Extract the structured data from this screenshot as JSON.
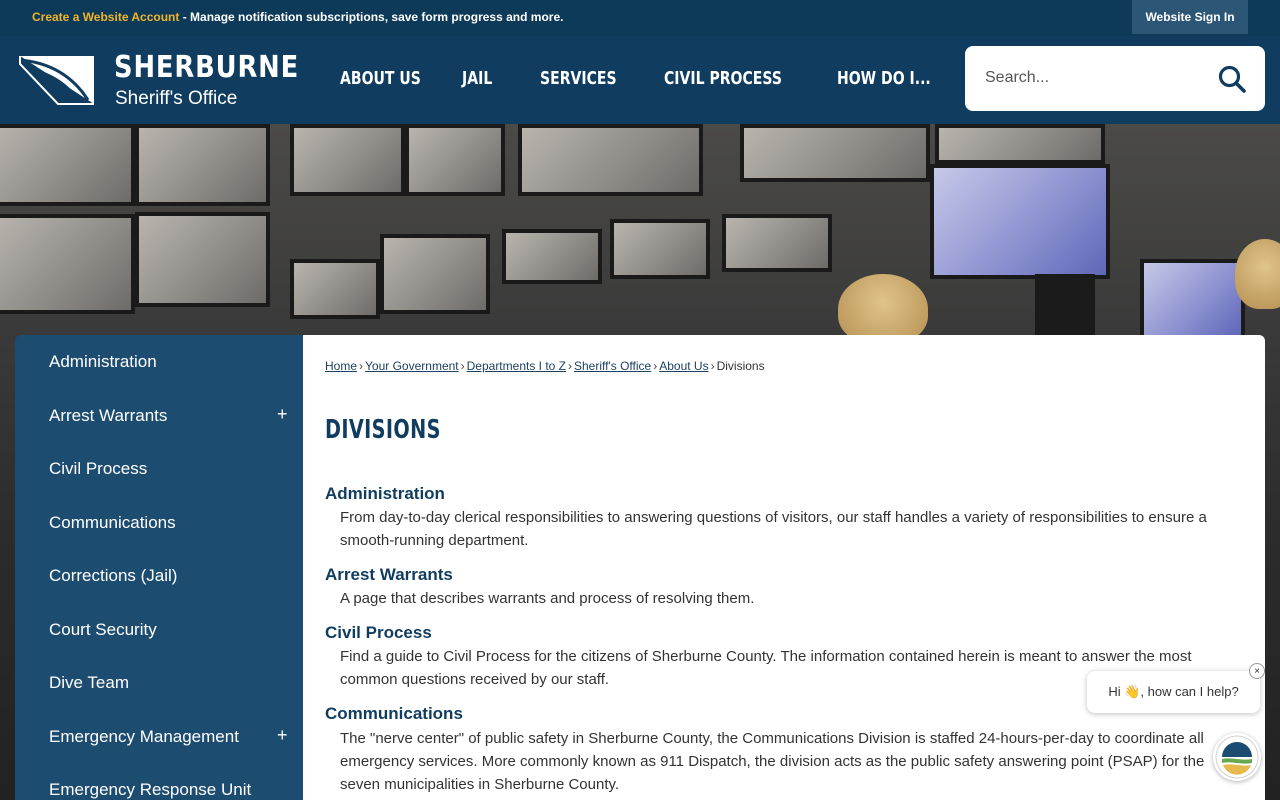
{
  "topbar": {
    "create_account_link": "Create a Website Account",
    "create_account_text": " - Manage notification subscriptions, save form progress and more.",
    "sign_in_label": "Website Sign In"
  },
  "header": {
    "logo_name": "SHERBURNE",
    "logo_sub": "Sheriff's Office",
    "nav": [
      "ABOUT US",
      "JAIL",
      "SERVICES",
      "CIVIL PROCESS",
      "HOW DO I..."
    ],
    "search_placeholder": "Search..."
  },
  "sidebar": {
    "items": [
      {
        "label": "Administration",
        "expandable": false
      },
      {
        "label": "Arrest Warrants",
        "expandable": true
      },
      {
        "label": "Civil Process",
        "expandable": false
      },
      {
        "label": "Communications",
        "expandable": false
      },
      {
        "label": "Corrections (Jail)",
        "expandable": false
      },
      {
        "label": "Court Security",
        "expandable": false
      },
      {
        "label": "Dive Team",
        "expandable": false
      },
      {
        "label": "Emergency Management",
        "expandable": true
      },
      {
        "label": "Emergency Response Unit",
        "expandable": false
      }
    ],
    "plus_symbol": "+"
  },
  "breadcrumb": {
    "links": [
      "Home",
      "Your Government",
      "Departments I to Z",
      "Sheriff's Office",
      "About Us"
    ],
    "current": "Divisions",
    "separator": "›"
  },
  "page_title": "DIVISIONS",
  "divisions": [
    {
      "title": "Administration",
      "desc": "From day-to-day clerical responsibilities to answering questions of visitors, our staff handles a variety of responsibilities to ensure a smooth-running department."
    },
    {
      "title": "Arrest Warrants",
      "desc": "A page that describes warrants and process of resolving them."
    },
    {
      "title": "Civil Process",
      "desc": "Find a guide to Civil Process for the citizens of Sherburne County. The information contained herein is meant to answer the most common questions received by our staff."
    },
    {
      "title": "Communications",
      "desc": "The \"nerve center\" of public safety in Sherburne County, the Communications Division is staffed 24-hours-per-day to coordinate all emergency services. More commonly known as 911 Dispatch, the division acts as the public safety answering point (PSAP) for the seven municipalities in Sherburne County."
    }
  ],
  "chat": {
    "greeting": "Hi 👋, how can I help?",
    "close_symbol": "×"
  },
  "colors": {
    "header_bg": "#0f3c5f",
    "topbar_bg": "#0e3a5a",
    "sidebar_bg": "#1d4c71",
    "accent_link": "#f0b429",
    "heading": "#0f3c5f"
  }
}
